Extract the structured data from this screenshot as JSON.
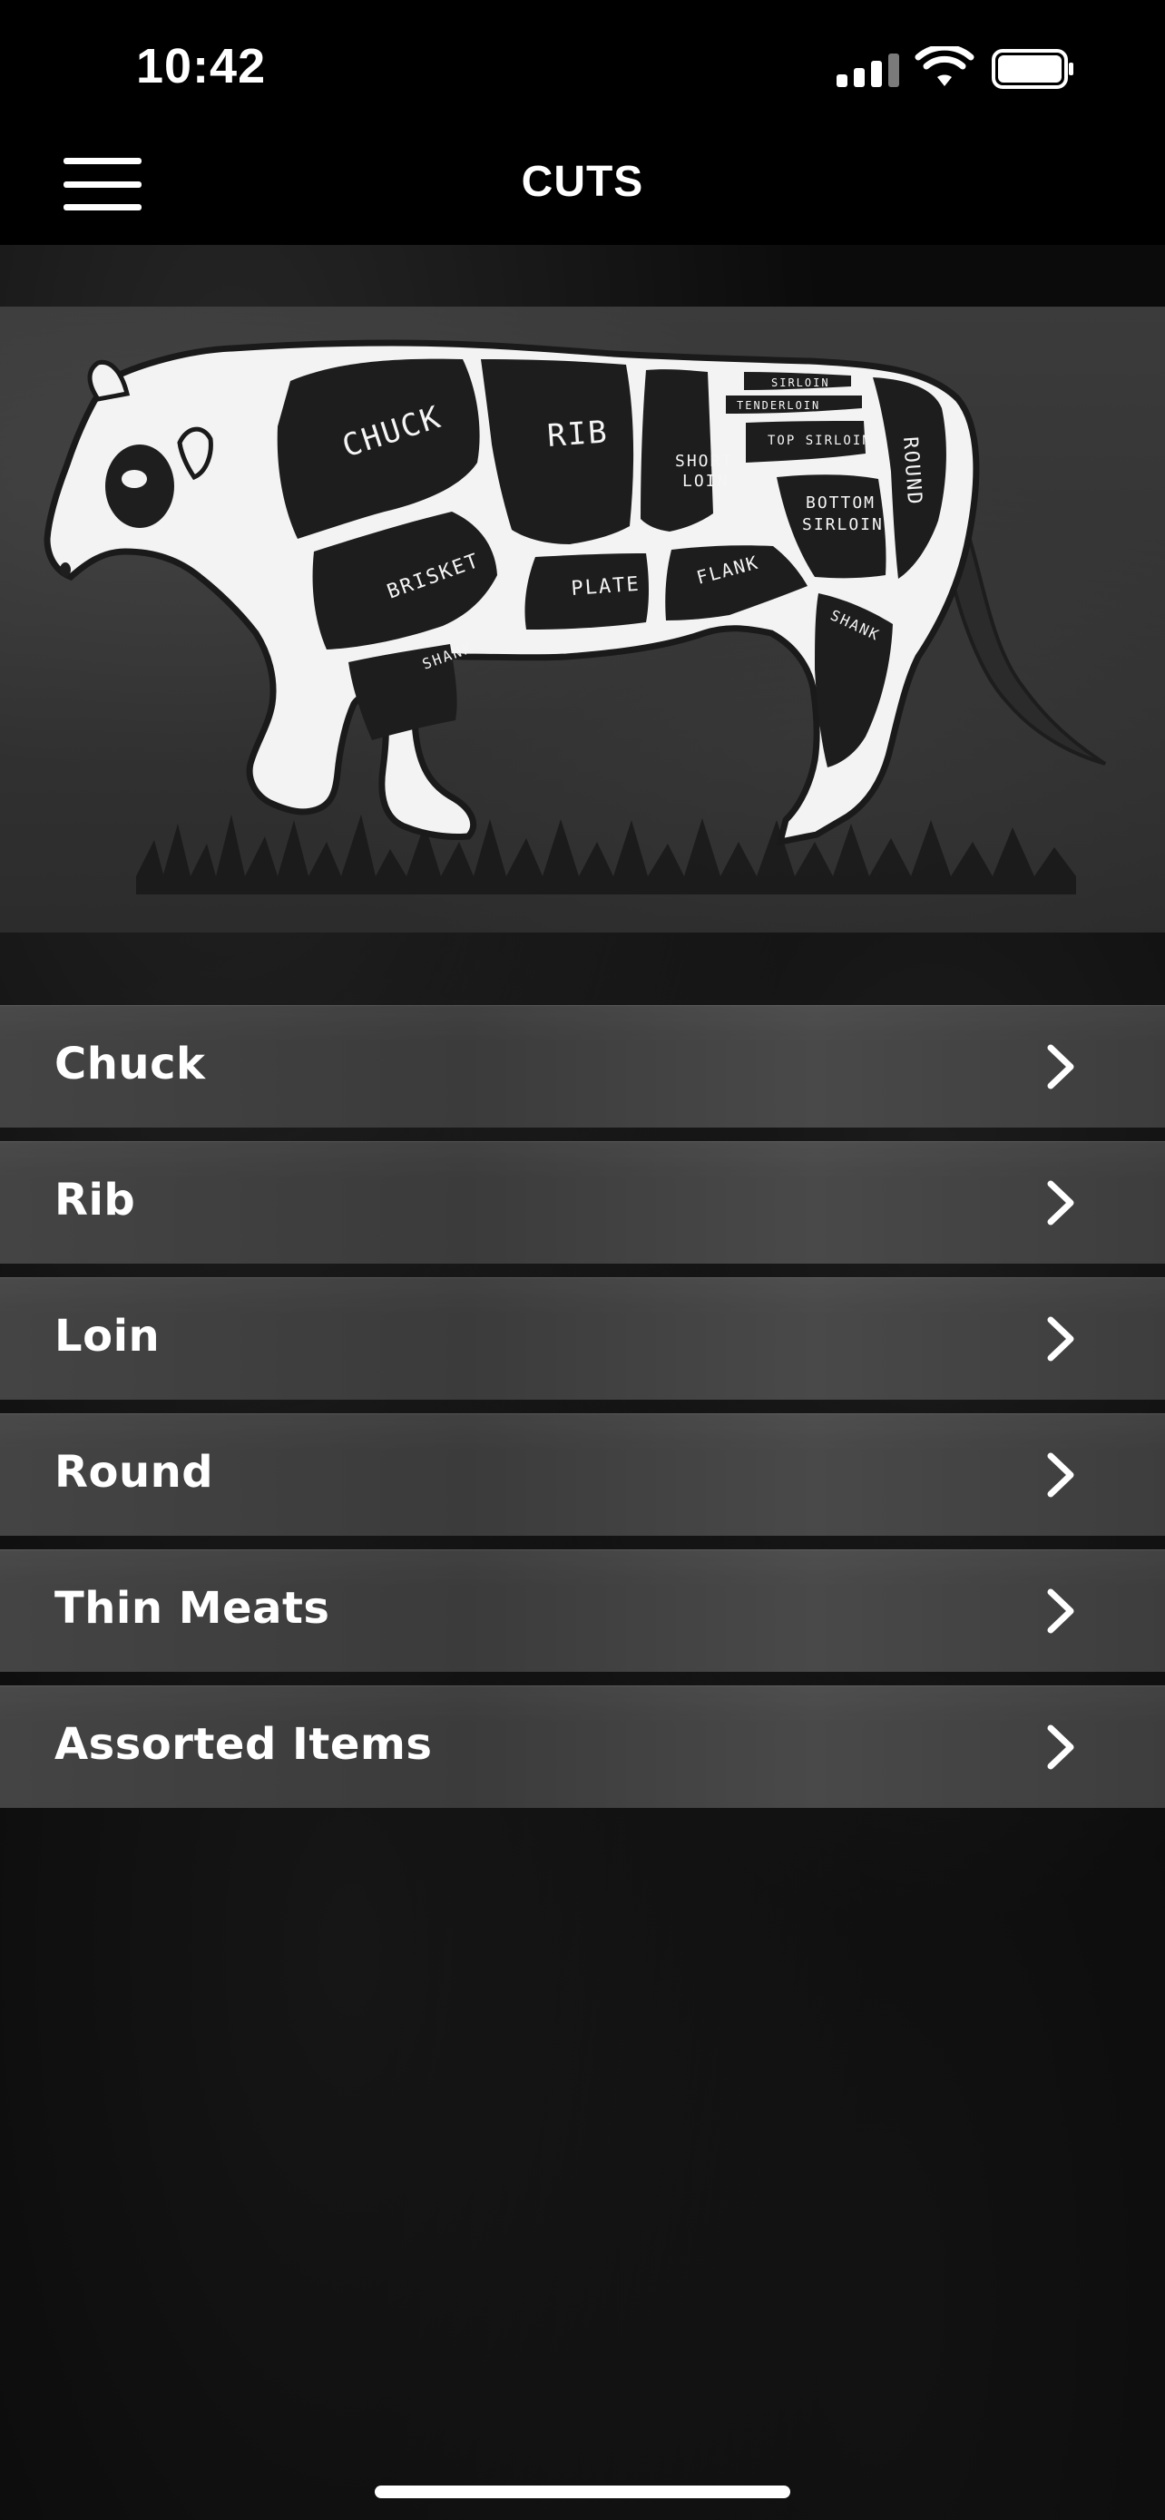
{
  "status_bar": {
    "time": "10:42",
    "signal_icon": "cellular-signal-icon",
    "wifi_icon": "wifi-icon",
    "battery_icon": "battery-icon"
  },
  "header": {
    "menu_icon": "hamburger-menu-icon",
    "title": "CUTS"
  },
  "diagram": {
    "labels": {
      "chuck": "CHUCK",
      "rib": "RIB",
      "short": "SHORT",
      "loin": "LOIN",
      "sirloin": "SIRLOIN",
      "tenderloin": "TENDERLOIN",
      "top_sirloin": "TOP SIRLOIN",
      "round": "ROUND",
      "bottom": "BOTTOM",
      "bottom_sirloin": "SIRLOIN",
      "brisket": "BRISKET",
      "plate": "PLATE",
      "flank": "FLANK",
      "front_shank": "SHANK",
      "rear_shank": "SHANK"
    }
  },
  "cuts": [
    {
      "label": "Chuck",
      "icon": "chevron-right-icon"
    },
    {
      "label": "Rib",
      "icon": "chevron-right-icon"
    },
    {
      "label": "Loin",
      "icon": "chevron-right-icon"
    },
    {
      "label": "Round",
      "icon": "chevron-right-icon"
    },
    {
      "label": "Thin Meats",
      "icon": "chevron-right-icon"
    },
    {
      "label": "Assorted Items",
      "icon": "chevron-right-icon"
    }
  ],
  "colors": {
    "background": "#050505",
    "header": "#000000",
    "row": "#434343",
    "text": "#ffffff"
  }
}
